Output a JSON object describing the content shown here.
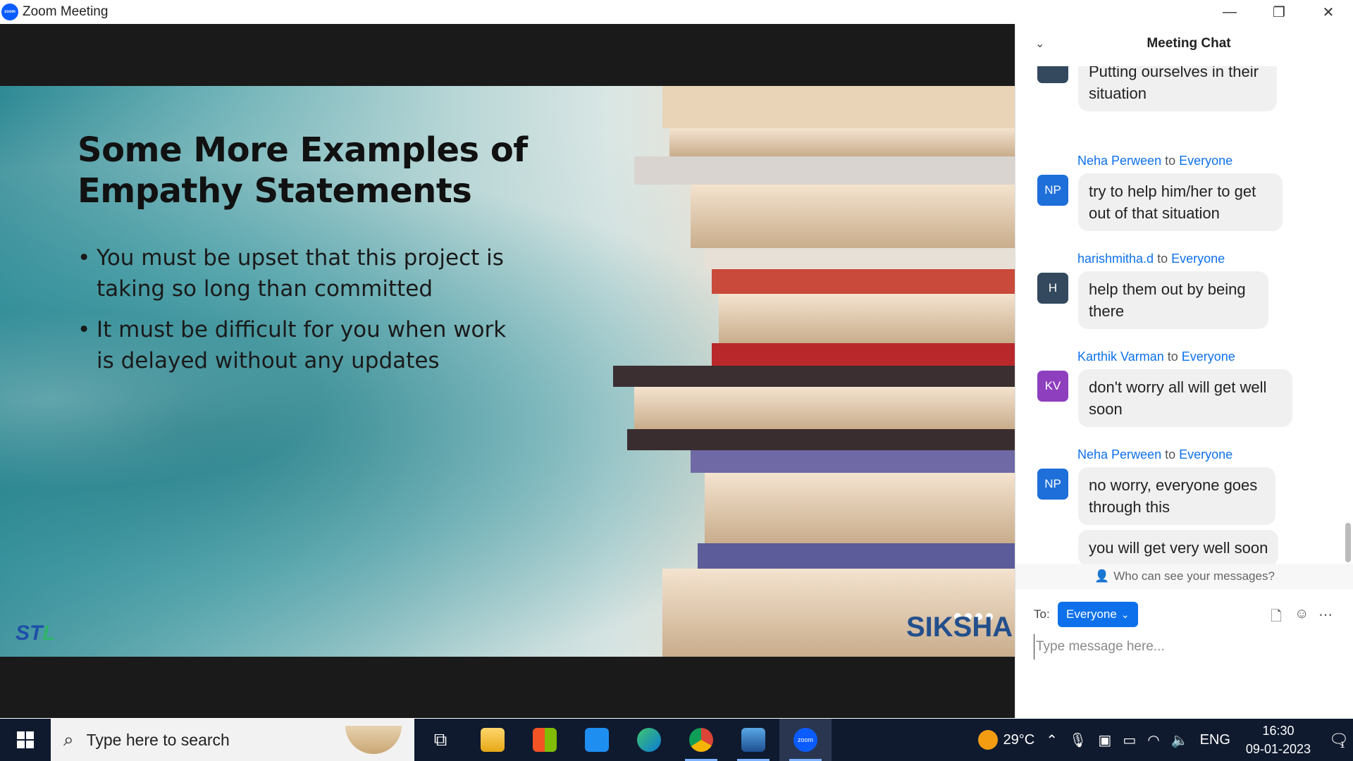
{
  "window": {
    "title": "Zoom Meeting",
    "logo_text": "zoom",
    "controls": {
      "minimize": "—",
      "restore": "❐",
      "close": "✕"
    }
  },
  "slide": {
    "title_line1": "Some More Examples of",
    "title_line2": "Empathy Statements",
    "bullets": [
      "You must be upset that this project is taking so long than committed",
      "It must be difficult for you when work is delayed without any updates"
    ],
    "logo_left_main": "ST",
    "logo_left_accent": "L",
    "logo_right": "SIKSHA"
  },
  "chat": {
    "title": "Meeting Chat",
    "partial_message": "Putting ourselves in their situation",
    "messages": [
      {
        "sender": "Neha Perween",
        "to_word": "to",
        "recipient": "Everyone",
        "initials": "NP",
        "avatar_color": "#1e6fd9",
        "texts": [
          "try to help him/her to get out of that situation"
        ]
      },
      {
        "sender": "harishmitha.d",
        "to_word": "to",
        "recipient": "Everyone",
        "initials": "H",
        "avatar_color": "#34495e",
        "texts": [
          "help them out by being there"
        ]
      },
      {
        "sender": "Karthik Varman",
        "to_word": "to",
        "recipient": "Everyone",
        "initials": "KV",
        "avatar_color": "#8e3fbe",
        "texts": [
          "don't worry all will get well soon"
        ]
      },
      {
        "sender": "Neha Perween",
        "to_word": "to",
        "recipient": "Everyone",
        "initials": "NP",
        "avatar_color": "#1e6fd9",
        "texts": [
          "no worry, everyone goes through this",
          "you will get very well soon"
        ]
      }
    ],
    "privacy_text": "Who can see your messages?",
    "to_label": "To:",
    "recipient_select": "Everyone",
    "input_placeholder": "Type message here...",
    "accent_color": "#0e71eb"
  },
  "taskbar": {
    "search_placeholder": "Type here to search",
    "apps": [
      "task-view",
      "file-explorer",
      "microsoft-store",
      "mail",
      "edge",
      "chrome",
      "photos",
      "zoom"
    ],
    "zoom_label": "zoom",
    "temperature": "29°C",
    "language": "ENG",
    "time": "16:30",
    "date": "09-01-2023",
    "notification_count": "1"
  }
}
